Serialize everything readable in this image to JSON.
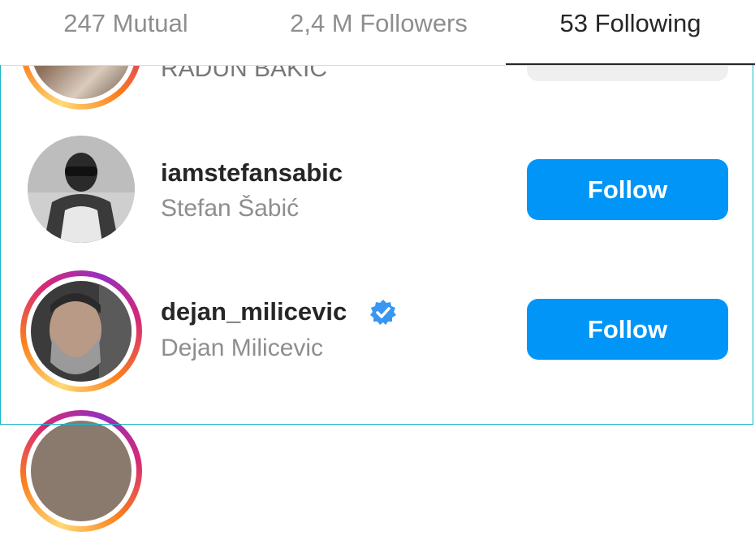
{
  "tabs": {
    "mutual": "247 Mutual",
    "followers": "2,4 M Followers",
    "following": "53 Following",
    "active": "following"
  },
  "list": [
    {
      "username": "",
      "full_name": "RADUN BAKIC",
      "button": "",
      "story_ring": true
    },
    {
      "username": "iamstefansabic",
      "full_name": "Stefan Šabić",
      "button": "Follow",
      "story_ring": false
    },
    {
      "username": "dejan_milicevic",
      "full_name": "Dejan Milicevic",
      "button": "Follow",
      "story_ring": true,
      "verified": true,
      "verified_icon": "verified-badge-icon"
    },
    {
      "username": "",
      "full_name": "",
      "button": "",
      "story_ring": true
    }
  ],
  "colors": {
    "follow_button": "#0095f6",
    "verified": "#3897f0",
    "secondary_text": "#8e8e8e",
    "primary_text": "#262626"
  }
}
